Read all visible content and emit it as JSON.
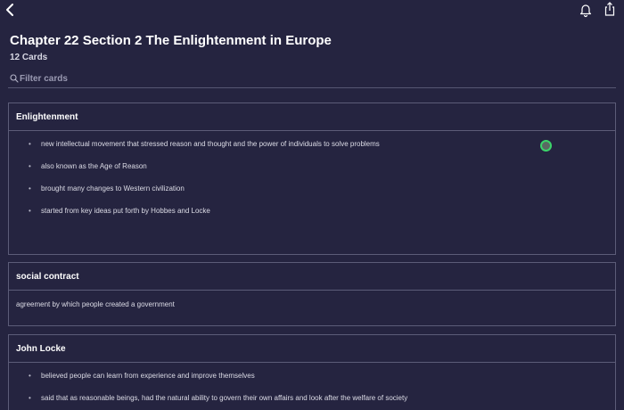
{
  "set": {
    "title": "Chapter 22 Section 2 The Enlightenment in Europe",
    "card_count": "12 Cards"
  },
  "filter": {
    "placeholder": "Filter cards"
  },
  "icons": {
    "back": "chevron-left-icon",
    "notifications": "bell-icon",
    "share": "share-icon",
    "filter": "search-icon"
  },
  "colors": {
    "background": "#252440",
    "card_border": "#5c5c78",
    "status_ring": "#3cd46a"
  },
  "cards": [
    {
      "term": "Enlightenment",
      "definition_items": [
        "new intellectual movement that stressed reason and thought and the power of individuals to solve problems",
        "also known as the Age of Reason",
        "brought many changes to Western civilization",
        "started from key ideas put forth by Hobbes and Locke"
      ]
    },
    {
      "term": "social contract",
      "definition": "agreement by which people created a government"
    },
    {
      "term": "John Locke",
      "definition_items": [
        "believed people can learn from experience and improve themselves",
        "said that as reasonable beings, had the natural ability to govern their own affairs and look after the welfare of society"
      ]
    }
  ]
}
